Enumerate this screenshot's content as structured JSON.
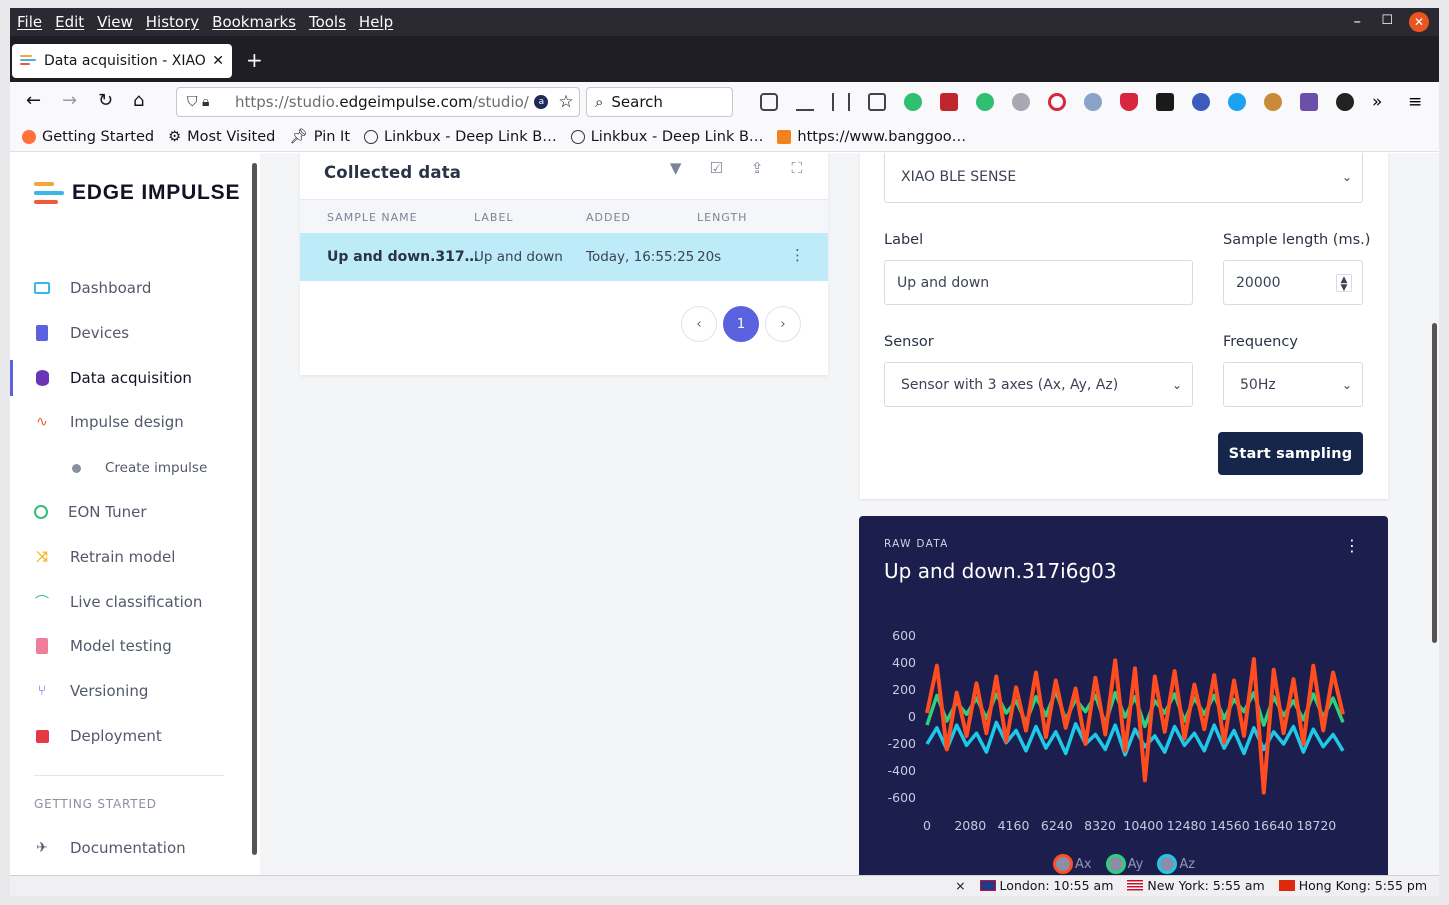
{
  "menu": [
    "File",
    "Edit",
    "View",
    "History",
    "Bookmarks",
    "Tools",
    "Help"
  ],
  "tab": {
    "title": "Data acquisition - XIAO BLE SENSE - Edge Impulse",
    "close": "✕"
  },
  "newtab": "+",
  "url": {
    "prefix": "https://studio.",
    "domain": "edgeimpulse.com",
    "suffix": "/studio/"
  },
  "search": {
    "label": "Search"
  },
  "bookmarks": [
    {
      "label": "Getting Started"
    },
    {
      "label": "Most Visited"
    },
    {
      "label": "Pin It"
    },
    {
      "label": "Linkbux - Deep Link B…"
    },
    {
      "label": "Linkbux - Deep Link B…"
    },
    {
      "label": "https://www.banggoo…"
    }
  ],
  "brand": {
    "name": "EDGE IMPULSE",
    "colors": [
      "#f0a83a",
      "#3cb7e5",
      "#f05a3c"
    ]
  },
  "sidebar": {
    "items": [
      {
        "label": "Dashboard",
        "icon": "monitor-icon",
        "color": "#3cb7e5"
      },
      {
        "label": "Devices",
        "icon": "chip-icon",
        "color": "#5b62e0"
      },
      {
        "label": "Data acquisition",
        "icon": "database-icon",
        "color": "#6a35b5"
      },
      {
        "label": "Impulse design",
        "icon": "pulse-icon",
        "color": "#f05a3c"
      },
      {
        "label": "EON Tuner",
        "icon": "compass-icon",
        "color": "#2fbf71"
      },
      {
        "label": "Retrain model",
        "icon": "shuffle-icon",
        "color": "#f0b82a"
      },
      {
        "label": "Live classification",
        "icon": "broadcast-icon",
        "color": "#2fbf71"
      },
      {
        "label": "Model testing",
        "icon": "clipboard-icon",
        "color": "#f07b9a"
      },
      {
        "label": "Versioning",
        "icon": "git-branch-icon",
        "color": "#5b62e0"
      },
      {
        "label": "Deployment",
        "icon": "box-icon",
        "color": "#e63946"
      }
    ],
    "sub": "Create impulse",
    "section": "GETTING STARTED",
    "doc": {
      "label": "Documentation",
      "icon": "rocket-icon"
    }
  },
  "collected": {
    "title": "Collected data",
    "columns": [
      "SAMPLE NAME",
      "LABEL",
      "ADDED",
      "LENGTH"
    ],
    "rows": [
      {
        "name": "Up and down.317…",
        "label": "Up and down",
        "added": "Today, 16:55:25",
        "length": "20s"
      }
    ],
    "page": "1"
  },
  "form": {
    "device": "XIAO BLE SENSE",
    "label_title": "Label",
    "label_value": "Up and down",
    "length_title": "Sample length (ms.)",
    "length_value": "20000",
    "sensor_title": "Sensor",
    "sensor_value": "Sensor with 3 axes (Ax, Ay, Az)",
    "freq_title": "Frequency",
    "freq_value": "50Hz",
    "start": "Start sampling"
  },
  "raw": {
    "kicker": "RAW DATA",
    "title": "Up and down.317i6g03"
  },
  "chart_data": {
    "type": "line",
    "yticks": [
      600,
      400,
      200,
      0,
      -200,
      -400,
      -600
    ],
    "xticks": [
      0,
      2080,
      4160,
      6240,
      8320,
      10400,
      12480,
      14560,
      16640,
      18720
    ],
    "ylim": [
      -600,
      600
    ],
    "xlim": [
      0,
      20000
    ],
    "series": [
      {
        "name": "Ax",
        "color": "#ff4d1f",
        "values": [
          30,
          380,
          -240,
          180,
          -140,
          250,
          -120,
          300,
          -180,
          220,
          -100,
          330,
          -150,
          270,
          -80,
          210,
          -200,
          290,
          -130,
          420,
          -250,
          360,
          -470,
          300,
          -110,
          340,
          -160,
          240,
          -90,
          310,
          -190,
          270,
          -140,
          430,
          -560,
          350,
          -120,
          280,
          -200,
          380,
          -100,
          330,
          20
        ]
      },
      {
        "name": "Ay",
        "color": "#2ed07a",
        "values": [
          -60,
          160,
          -30,
          110,
          20,
          140,
          -10,
          170,
          30,
          120,
          -40,
          150,
          10,
          190,
          -20,
          130,
          40,
          160,
          -50,
          180,
          0,
          150,
          -70,
          120,
          30,
          170,
          -30,
          140,
          20,
          160,
          -10,
          130,
          40,
          180,
          -60,
          150,
          10,
          120,
          -20,
          170,
          0,
          140,
          -40
        ]
      },
      {
        "name": "Az",
        "color": "#1ec8e8",
        "values": [
          -200,
          -80,
          -240,
          -60,
          -210,
          -120,
          -260,
          -40,
          -190,
          -100,
          -250,
          -70,
          -230,
          -110,
          -270,
          -50,
          -200,
          -130,
          -240,
          -60,
          -280,
          -90,
          -220,
          -140,
          -260,
          -70,
          -210,
          -120,
          -250,
          -60,
          -230,
          -100,
          -270,
          -80,
          -240,
          -110,
          -200,
          -70,
          -260,
          -90,
          -220,
          -130,
          -250
        ]
      }
    ]
  },
  "statusbar": {
    "close": "×",
    "london": "London: 10:55 am",
    "newyork": "New York: 5:55 am",
    "hongkong": "Hong Kong: 5:55 pm"
  }
}
